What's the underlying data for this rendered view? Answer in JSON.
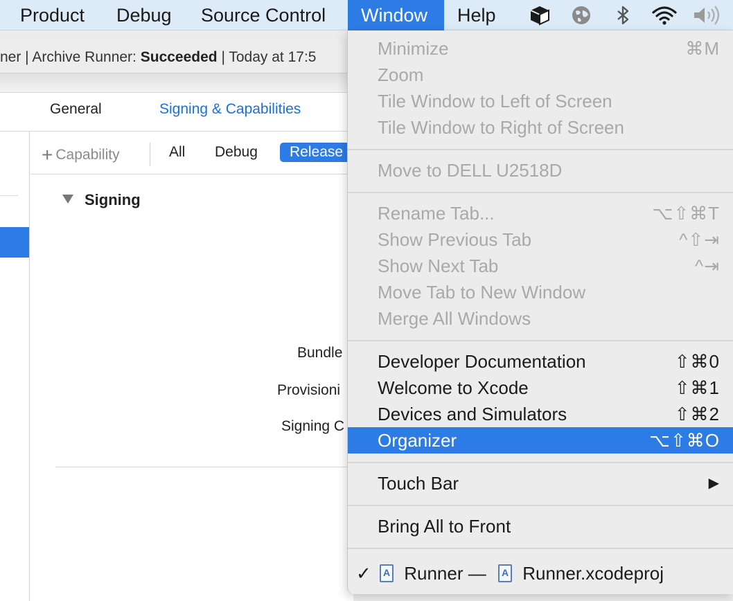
{
  "menubar": {
    "items": [
      "Product",
      "Debug",
      "Source Control",
      "Window",
      "Help"
    ],
    "active": "Window",
    "status_icons": [
      "cube-icon",
      "globe-icon",
      "bluetooth-icon",
      "wifi-icon",
      "volume-icon"
    ]
  },
  "activity": {
    "prefix": "ner | Archive Runner: ",
    "status": "Succeeded",
    "suffix": " | Today at 17:5"
  },
  "editor": {
    "tabs": [
      "General",
      "Signing & Capabilities"
    ],
    "add_capability": "Capability",
    "filters": [
      "All",
      "Debug",
      "Release"
    ],
    "selected_filter": "Release",
    "section": "Signing",
    "field_labels": [
      "Bundle",
      "Provisioni",
      "Signing C"
    ]
  },
  "menu": {
    "groups": [
      {
        "items": [
          {
            "label": "Minimize",
            "shortcut": "⌘M",
            "enabled": false
          },
          {
            "label": "Zoom",
            "shortcut": "",
            "enabled": false
          },
          {
            "label": "Tile Window to Left of Screen",
            "shortcut": "",
            "enabled": false
          },
          {
            "label": "Tile Window to Right of Screen",
            "shortcut": "",
            "enabled": false
          }
        ]
      },
      {
        "items": [
          {
            "label": "Move to DELL U2518D",
            "shortcut": "",
            "enabled": false
          }
        ]
      },
      {
        "items": [
          {
            "label": "Rename Tab...",
            "shortcut": "⌥⇧⌘T",
            "enabled": false
          },
          {
            "label": "Show Previous Tab",
            "shortcut": "^⇧⇥",
            "enabled": false
          },
          {
            "label": "Show Next Tab",
            "shortcut": "^⇥",
            "enabled": false
          },
          {
            "label": "Move Tab to New Window",
            "shortcut": "",
            "enabled": false
          },
          {
            "label": "Merge All Windows",
            "shortcut": "",
            "enabled": false
          }
        ]
      },
      {
        "items": [
          {
            "label": "Developer Documentation",
            "shortcut": "⇧⌘0",
            "enabled": true
          },
          {
            "label": "Welcome to Xcode",
            "shortcut": "⇧⌘1",
            "enabled": true
          },
          {
            "label": "Devices and Simulators",
            "shortcut": "⇧⌘2",
            "enabled": true
          },
          {
            "label": "Organizer",
            "shortcut": "⌥⇧⌘O",
            "enabled": true,
            "highlighted": true
          }
        ]
      },
      {
        "items": [
          {
            "label": "Touch Bar",
            "shortcut": "▶",
            "enabled": true
          }
        ]
      },
      {
        "items": [
          {
            "label": "Bring All to Front",
            "shortcut": "",
            "enabled": true
          }
        ]
      }
    ],
    "window_entry": {
      "checked": true,
      "name": "Runner —",
      "project": "Runner.xcodeproj"
    }
  },
  "colors": {
    "accent": "#2d7be5",
    "menubar_bg": "#dcebf7",
    "disabled_text": "#a9a9a9",
    "link_blue": "#1b6fe0"
  }
}
